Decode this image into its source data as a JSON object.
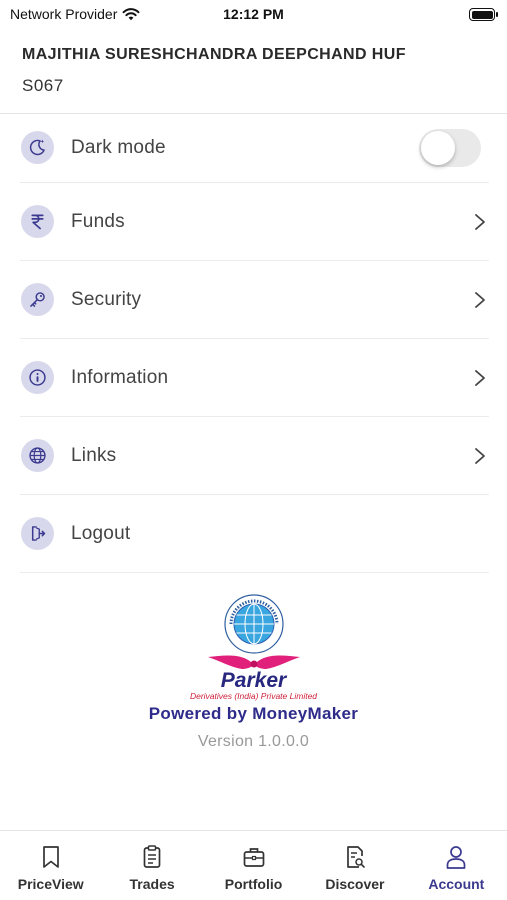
{
  "status_bar": {
    "carrier": "Network Provider",
    "time": "12:12 PM"
  },
  "account": {
    "name": "MAJITHIA SURESHCHANDRA DEEPCHAND HUF",
    "code": "S067"
  },
  "menu": {
    "items": [
      {
        "label": "Dark mode",
        "icon": "moon-icon",
        "control": "toggle",
        "enabled": false
      },
      {
        "label": "Funds",
        "icon": "rupee-icon",
        "control": "chevron"
      },
      {
        "label": "Security",
        "icon": "key-icon",
        "control": "chevron"
      },
      {
        "label": "Information",
        "icon": "info-icon",
        "control": "chevron"
      },
      {
        "label": "Links",
        "icon": "globe-icon",
        "control": "chevron"
      },
      {
        "label": "Logout",
        "icon": "logout-icon",
        "control": "none"
      }
    ]
  },
  "brand": {
    "logo_name": "Parker",
    "logo_subtitle": "Derivatives (India) Private Limited",
    "logo_seal_text": "PARKER DERIVATIVES (INDIA) PVT LTD",
    "powered_by": "Powered by MoneyMaker",
    "version": "Version 1.0.0.0"
  },
  "tabs": [
    {
      "label": "PriceView",
      "icon": "bookmark-icon",
      "active": false
    },
    {
      "label": "Trades",
      "icon": "clipboard-icon",
      "active": false
    },
    {
      "label": "Portfolio",
      "icon": "briefcase-icon",
      "active": false
    },
    {
      "label": "Discover",
      "icon": "search-document-icon",
      "active": false
    },
    {
      "label": "Account",
      "icon": "user-icon",
      "active": true
    }
  ],
  "colors": {
    "accent": "#3b3a8f",
    "icon_bg": "#d8d8ec",
    "brand_red": "#d0203a",
    "brand_blue": "#27277f"
  }
}
